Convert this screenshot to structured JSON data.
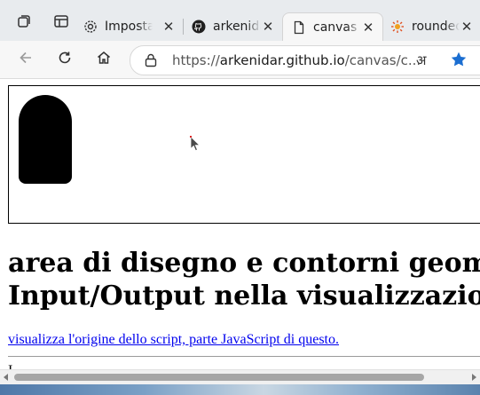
{
  "browser": {
    "tabs": [
      {
        "label": "Impostazioni",
        "icon": "gear-icon",
        "active": false
      },
      {
        "label": "arkenidar",
        "icon": "github-icon",
        "active": false
      },
      {
        "label": "canvas",
        "icon": "page-icon",
        "active": true
      },
      {
        "label": "rounded",
        "icon": "sun-favicon-icon",
        "active": false
      }
    ],
    "address_bar": {
      "scheme": "https://",
      "host": "arkenidar.github.io",
      "path": "/canvas/c..."
    }
  },
  "page": {
    "heading_line1": "area di disegno e contorni geometrici ca",
    "heading_line2": "Input/Output nella visualizzazione.",
    "link_text": "visualizza l'origine dello script, parte JavaScript di questo.",
    "cut_text": "I"
  },
  "colors": {
    "tab_bg": "#e8ebee",
    "toolbar_bg": "#f7f7f7",
    "link": "#0000ee",
    "favorite_star": "#1b6ed1"
  }
}
